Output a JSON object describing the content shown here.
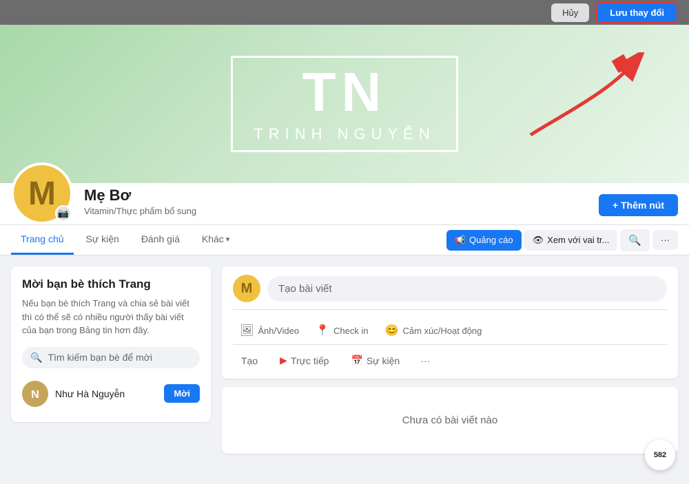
{
  "topbar": {
    "cancel_label": "Hủy",
    "save_label": "Lưu thay đổi"
  },
  "cover": {
    "initials": "TN",
    "name": "TRINH NGUYỄN"
  },
  "profile": {
    "avatar_letter": "M",
    "name": "Mẹ Bơ",
    "subtitle": "Vitamin/Thực phẩm bổ sung",
    "add_button": "+ Thêm nút"
  },
  "nav": {
    "tabs": [
      {
        "label": "Trang chủ",
        "active": true
      },
      {
        "label": "Sự kiện",
        "active": false
      },
      {
        "label": "Đánh giá",
        "active": false
      },
      {
        "label": "Khác",
        "active": false,
        "has_arrow": true
      }
    ],
    "buttons": [
      {
        "label": "Quảng cáo",
        "icon": "📢"
      },
      {
        "label": "Xem với vai tr...",
        "icon": "👁"
      },
      {
        "label": "🔍",
        "search": true
      },
      {
        "label": "···",
        "more": true
      }
    ]
  },
  "sidebar": {
    "title": "Mời bạn bè thích Trang",
    "description": "Nếu bạn bè thích Trang và chia sẻ bài viết thì có thể sẽ có nhiều người thấy bài viết của bạn trong Bảng tin hơn đây.",
    "search_placeholder": "Tìm kiếm bạn bè để mời",
    "friends": [
      {
        "name": "Như Hà Nguyễn",
        "invite_label": "Mời",
        "color": "#c5a55a",
        "letter": "N"
      }
    ]
  },
  "post_box": {
    "create_label": "Tạo bài viết",
    "avatar_letter": "M",
    "actions_row1": [
      {
        "label": "Ảnh/Video",
        "icon": "🖼"
      },
      {
        "label": "Check in",
        "icon": "📍"
      },
      {
        "label": "Cảm xúc/Hoạt động",
        "icon": "😊"
      }
    ],
    "tao_label": "Tạo",
    "truc_tiep_label": "Trực tiếp",
    "truc_tiep_icon": "▶",
    "su_kien_label": "Sự kiện",
    "su_kien_icon": "📅",
    "more_label": "···"
  },
  "empty_state": {
    "text": "Chưa có bài viết nào"
  },
  "badge": {
    "label": "582"
  }
}
